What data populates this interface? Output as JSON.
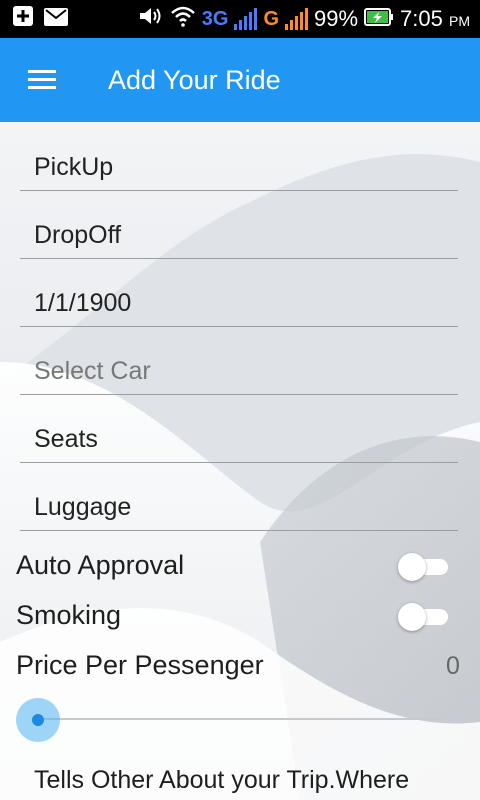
{
  "status_bar": {
    "battery": "99%",
    "time": "7:05",
    "ampm": "PM",
    "network_1": "3G",
    "network_2": "G"
  },
  "app_bar": {
    "title": "Add Your Ride"
  },
  "form": {
    "pickup": "PickUp",
    "dropoff": "DropOff",
    "date": "1/1/1900",
    "select_car_placeholder": "Select Car",
    "seats": "Seats",
    "luggage": "Luggage"
  },
  "toggles": {
    "auto_approval_label": "Auto Approval",
    "auto_approval_on": false,
    "smoking_label": "Smoking",
    "smoking_on": false
  },
  "price": {
    "label": "Price Per Pessenger",
    "value": "0",
    "slider_fraction": 0
  },
  "description_prompt": "Tells Other About your Trip.Where",
  "colors": {
    "app_bar": "#2196f3",
    "slider_accent": "#1e88e5"
  }
}
